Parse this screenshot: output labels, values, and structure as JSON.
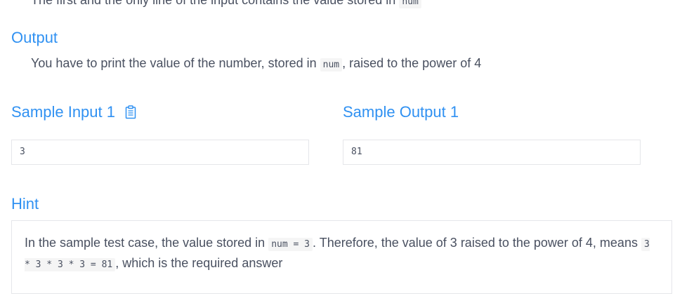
{
  "input_section": {
    "text_before": "The first and the only line of the input contains the value stored in",
    "code": "num"
  },
  "output_section": {
    "title": "Output",
    "text_before": "You have to print the value of the number, stored in",
    "code": "num",
    "text_after": ", raised to the power of 4"
  },
  "sample_input": {
    "title": "Sample Input 1",
    "copy_icon": "clipboard-icon",
    "value": "3"
  },
  "sample_output": {
    "title": "Sample Output 1",
    "value": "81"
  },
  "hint": {
    "title": "Hint",
    "text_1": "In the sample test case, the value stored in",
    "code_1": "num = 3",
    "text_2": ". Therefore, the value of 3 raised to the power of 4, means",
    "code_2": "3 * 3 * 3 * 3 = 81",
    "text_3": ", which is the required answer"
  },
  "colors": {
    "accent": "#3091f2",
    "text": "#495060",
    "border": "#e5e6ea",
    "code_bg": "#f5f5f5"
  }
}
